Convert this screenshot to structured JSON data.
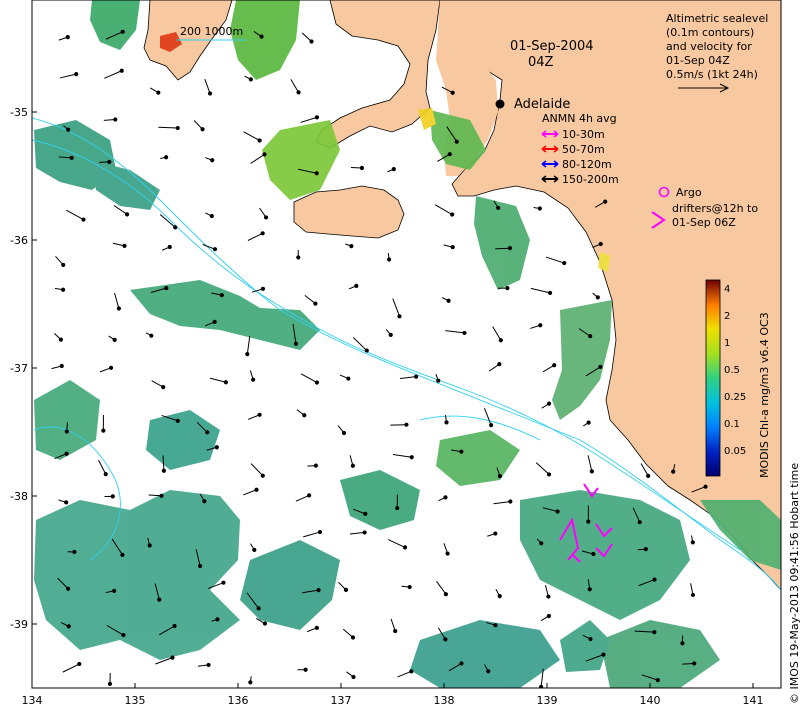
{
  "map": {
    "date_line": "01-Sep-2004",
    "time_line": "04Z",
    "place_label": "Adelaide",
    "scale_label": "200 1000m",
    "x_ticks": [
      "134",
      "135",
      "136",
      "137",
      "138",
      "139",
      "140",
      "141"
    ],
    "y_ticks": [
      "-35",
      "-36",
      "-37",
      "-38",
      "-39"
    ]
  },
  "legend_altimetry": {
    "lines": [
      "Altimetric sealevel",
      "(0.1m contours)",
      "and velocity for",
      "01-Sep 04Z",
      "0.5m/s (1kt 24h)"
    ]
  },
  "legend_anmn": {
    "title": "ANMN 4h avg",
    "items": [
      {
        "label": "10-30m",
        "color": "#ff00ff"
      },
      {
        "label": "50-70m",
        "color": "#ff0000"
      },
      {
        "label": "80-120m",
        "color": "#0000ff"
      },
      {
        "label": "150-200m",
        "color": "#000000"
      }
    ]
  },
  "legend_argo": {
    "argo_label": "Argo",
    "drifter_lines": [
      "drifters@12h to",
      "01-Sep 06Z"
    ],
    "color": "#ff00ff"
  },
  "colorbar": {
    "label": "MODIS Chl-a mg/m3 v6.4 OC3",
    "ticks": [
      "4",
      "2",
      "1",
      "0.5",
      "0.25",
      "0.1",
      "0.05"
    ]
  },
  "credit": "© IMOS 19-May-2013 09:41:56 Hobart time",
  "colors": {
    "land": "#f8c8a0",
    "ocean": "#ffffff",
    "contour": "#30d0f0",
    "chl_low": "#40b0a0",
    "chl_mid": "#50c060",
    "chl_high": "#90d030"
  }
}
